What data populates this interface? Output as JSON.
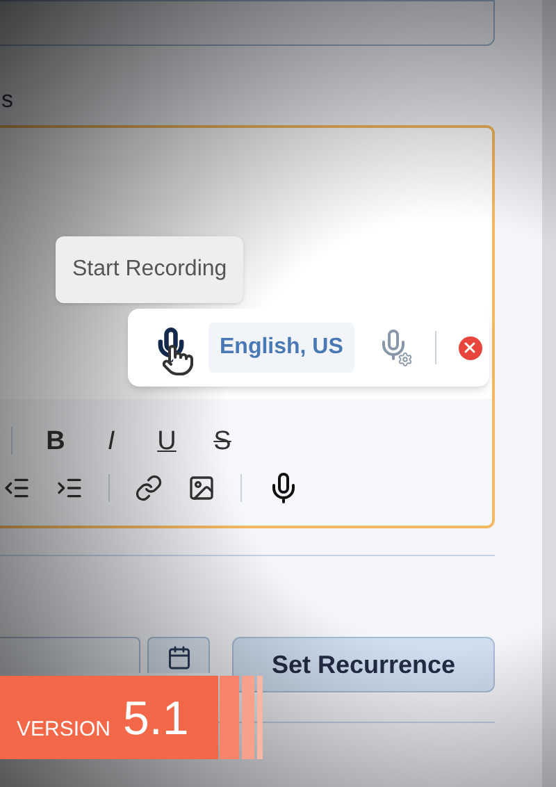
{
  "field_label": "s",
  "speech_popup": {
    "tooltip": "Start Recording",
    "language": "English, US"
  },
  "format_buttons": [
    {
      "kind": "bold",
      "label": "B"
    },
    {
      "kind": "italic",
      "label": "I"
    },
    {
      "kind": "underline",
      "label": "U"
    },
    {
      "kind": "strike",
      "label": "S"
    }
  ],
  "recurrence_button": "Set Recurrence",
  "banner": {
    "word": "VERSION",
    "number": "5.1"
  }
}
